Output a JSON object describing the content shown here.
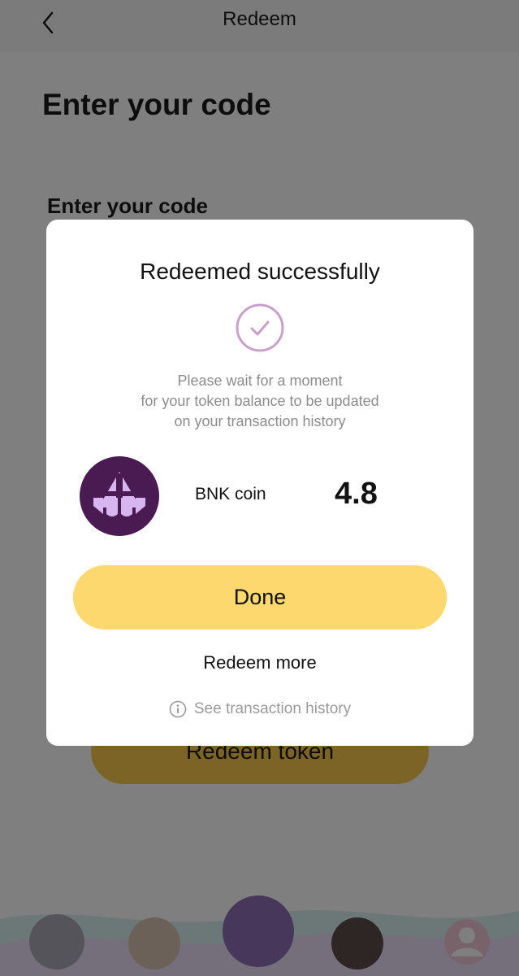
{
  "header": {
    "title": "Redeem",
    "back_icon": "chevron-left-icon"
  },
  "page": {
    "title": "Enter your code",
    "field_label": "Enter your code",
    "redeem_button_label": "Redeem token"
  },
  "modal": {
    "title": "Redeemed successfully",
    "status_icon": "check-circle-icon",
    "message_lines": [
      "Please wait for a moment",
      "for your token balance to be updated",
      "on your transaction history"
    ],
    "coin": {
      "logo_icon": "bnk-coin-logo",
      "name": "BNK coin",
      "amount": "4.8"
    },
    "done_label": "Done",
    "redeem_more_label": "Redeem more",
    "history_label": "See transaction history",
    "history_icon": "info-icon"
  },
  "colors": {
    "accent_yellow": "#fdd86f",
    "coin_purple": "#4a1b52",
    "success_check": "#c9a0c9",
    "overlay": "rgba(0,0,0,0.5)"
  }
}
